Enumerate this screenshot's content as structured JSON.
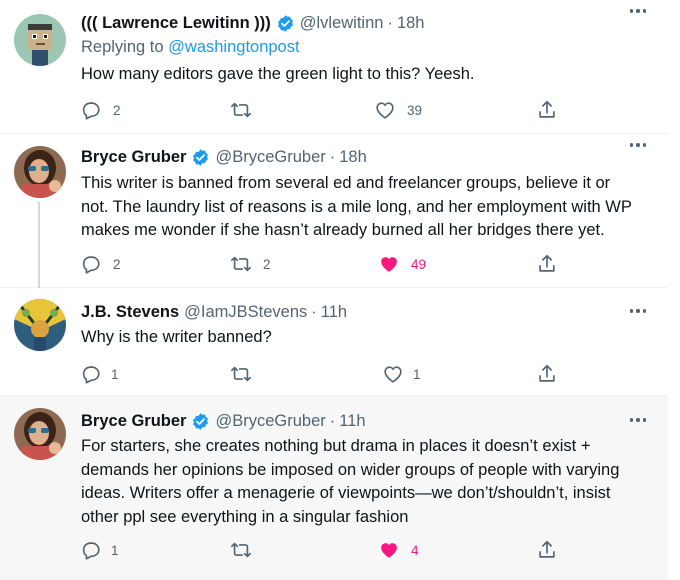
{
  "colors": {
    "accent": "#1d9bf0",
    "like_active": "#f91880",
    "muted": "#536471",
    "text": "#0f1419",
    "highlight_bg": "#f7f7f7"
  },
  "tweets": [
    {
      "name": "((( Lawrence Lewitinn )))",
      "verified": true,
      "handle": "@lvlewitinn",
      "time": "18h",
      "reply_prefix": "Replying to",
      "reply_to": "@washingtonpost",
      "lines": [
        "How many editors gave the green light to this? Yeesh."
      ],
      "reply_count": "2",
      "retweet_count": "",
      "like_count": "39",
      "liked": false,
      "avatar": "pixel-art-avatar"
    },
    {
      "name": "Bryce Gruber",
      "verified": true,
      "handle": "@BryceGruber",
      "time": "18h",
      "lines": [
        "This writer is banned from several ed and freelancer groups, believe it or",
        "not. The laundry list of reasons is a mile long, and her employment with WP",
        "makes me wonder if she hasn’t already burned all her bridges there yet."
      ],
      "reply_count": "2",
      "retweet_count": "2",
      "like_count": "49",
      "liked": true,
      "avatar": "photo-avatar"
    },
    {
      "name": "J.B. Stevens",
      "verified": false,
      "handle": "@IamJBStevens",
      "time": "11h",
      "lines": [
        "Why is the writer banned?"
      ],
      "reply_count": "1",
      "retweet_count": "",
      "like_count": "1",
      "liked": false,
      "avatar": "illustrated-avatar"
    },
    {
      "name": "Bryce Gruber",
      "verified": true,
      "handle": "@BryceGruber",
      "time": "11h",
      "lines": [
        "For starters, she creates nothing but drama in places it doesn’t exist +",
        "demands her opinions be imposed on wider groups of people with varying",
        "ideas. Writers offer a menagerie of viewpoints—we don’t/shouldn’t, insist",
        "other ppl see everything in a singular fashion"
      ],
      "reply_count": "1",
      "retweet_count": "",
      "like_count": "4",
      "liked": true,
      "avatar": "photo-avatar"
    }
  ],
  "icons": {
    "reply": "reply-icon",
    "retweet": "retweet-icon",
    "like": "heart-icon",
    "share": "share-icon",
    "more": "more-icon",
    "verified": "verified-badge-icon"
  }
}
